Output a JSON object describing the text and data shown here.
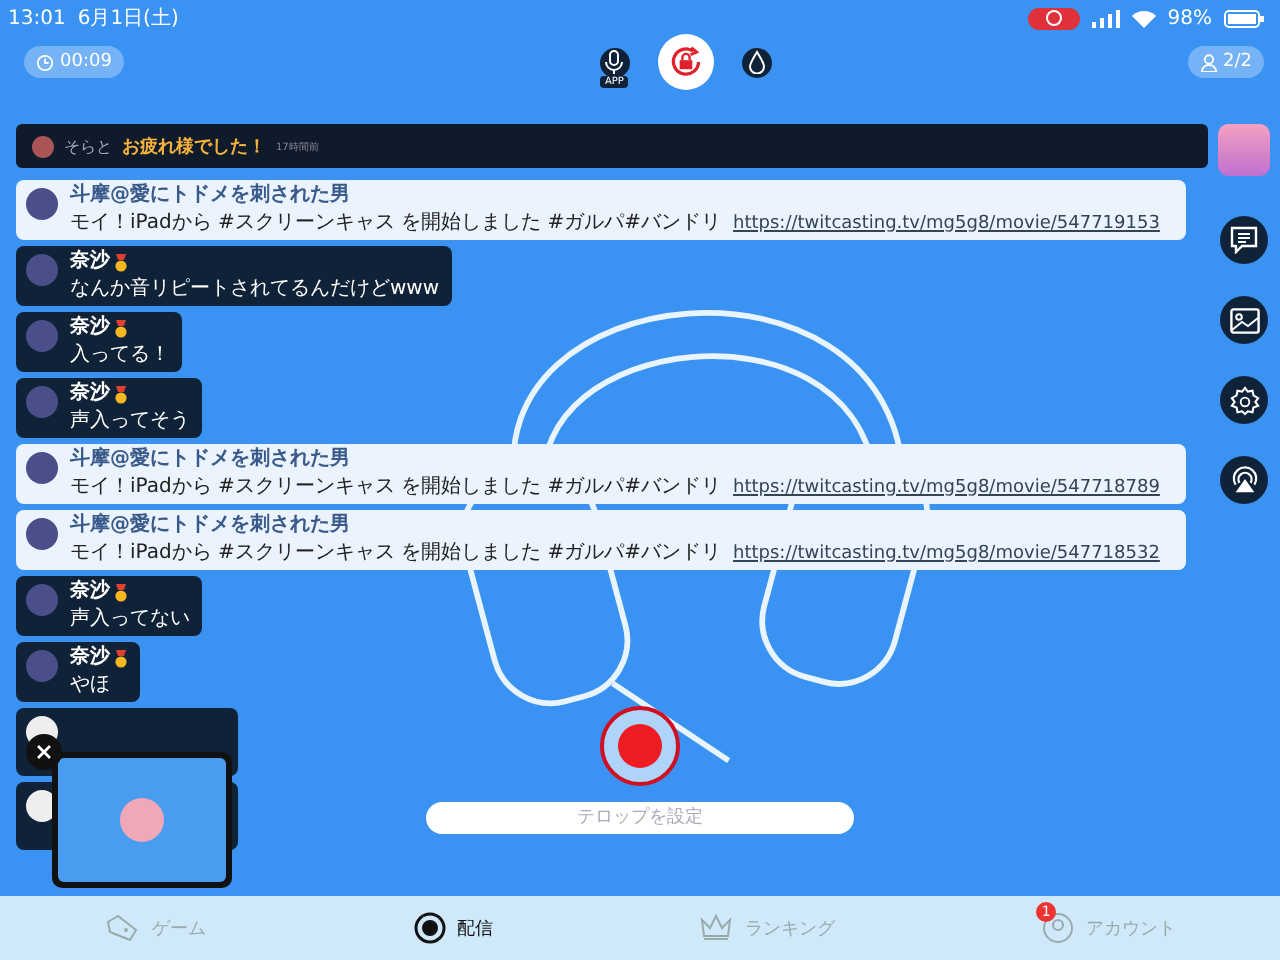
{
  "status_bar": {
    "time": "13:01",
    "date": "6月1日(土)",
    "battery": "98%",
    "recording": true
  },
  "top_bar": {
    "timer": "00:09",
    "mic_label": "APP",
    "viewers": "2/2"
  },
  "pinned_comment": {
    "user": "そらと",
    "message": "お疲れ様でした！",
    "time": "17時間前"
  },
  "comments": [
    {
      "kind": "announce",
      "user": "斗摩@愛にトドメを刺された男",
      "text": "モイ！iPadから #スクリーンキャス を開始しました #ガルパ#バンドリ",
      "link": "https://twitcasting.tv/mg5g8/movie/547719153"
    },
    {
      "kind": "comment",
      "user": "奈沙",
      "text": "なんか音リピートされてるんだけどwww"
    },
    {
      "kind": "comment",
      "user": "奈沙",
      "text": "入ってる！"
    },
    {
      "kind": "comment",
      "user": "奈沙",
      "text": "声入ってそう"
    },
    {
      "kind": "announce",
      "user": "斗摩@愛にトドメを刺された男",
      "text": "モイ！iPadから #スクリーンキャス を開始しました #ガルパ#バンドリ",
      "link": "https://twitcasting.tv/mg5g8/movie/547718789"
    },
    {
      "kind": "announce",
      "user": "斗摩@愛にトドメを刺された男",
      "text": "モイ！iPadから #スクリーンキャス を開始しました #ガルパ#バンドリ",
      "link": "https://twitcasting.tv/mg5g8/movie/547718532"
    },
    {
      "kind": "comment",
      "user": "奈沙",
      "text": "声入ってない"
    },
    {
      "kind": "comment",
      "user": "奈沙",
      "text": "やほ"
    }
  ],
  "telop": {
    "placeholder": "テロップを設定"
  },
  "tabs": [
    {
      "label": "ゲーム",
      "selected": false
    },
    {
      "label": "配信",
      "selected": true
    },
    {
      "label": "ランキング",
      "selected": false
    },
    {
      "label": "アカウント",
      "selected": false,
      "badge": "1"
    }
  ]
}
